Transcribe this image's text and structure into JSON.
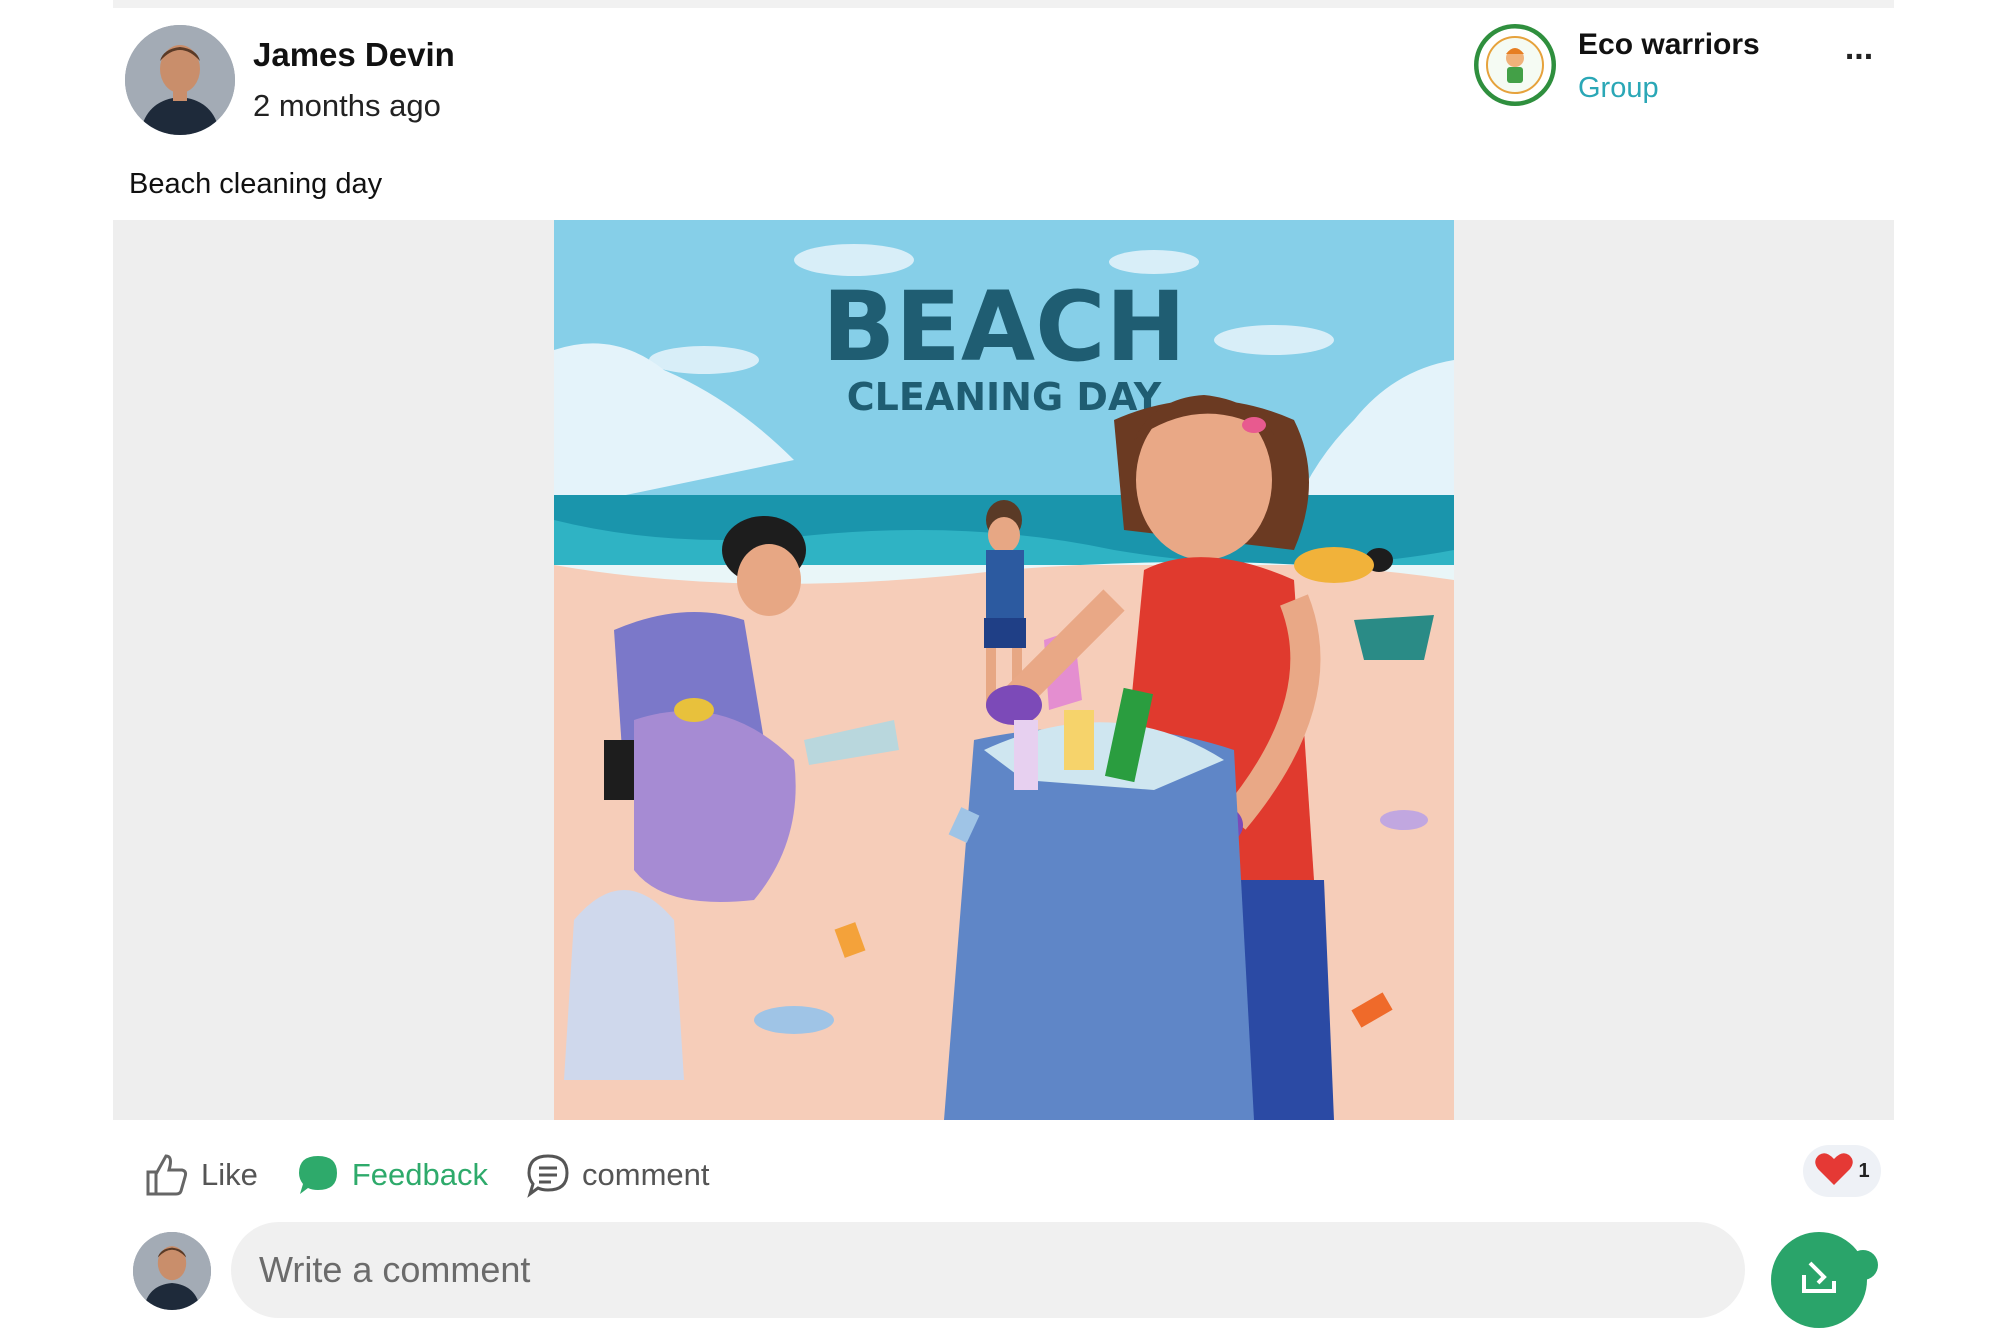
{
  "post": {
    "author_name": "James Devin",
    "timestamp": "2 months ago",
    "group_name": "Eco warriors",
    "group_type": "Group",
    "more_label": "...",
    "caption": "Beach cleaning day"
  },
  "image": {
    "title_line1": "BEACH",
    "title_line2": "CLEANING DAY"
  },
  "actions": {
    "like_label": "Like",
    "feedback_label": "Feedback",
    "comment_label": "comment"
  },
  "reactions": {
    "icon": "heart-icon",
    "count": "1"
  },
  "comment_box": {
    "placeholder": "Write a comment"
  },
  "colors": {
    "accent_green": "#2aa46a",
    "group_link": "#2aa7b6",
    "heart": "#e53935"
  }
}
